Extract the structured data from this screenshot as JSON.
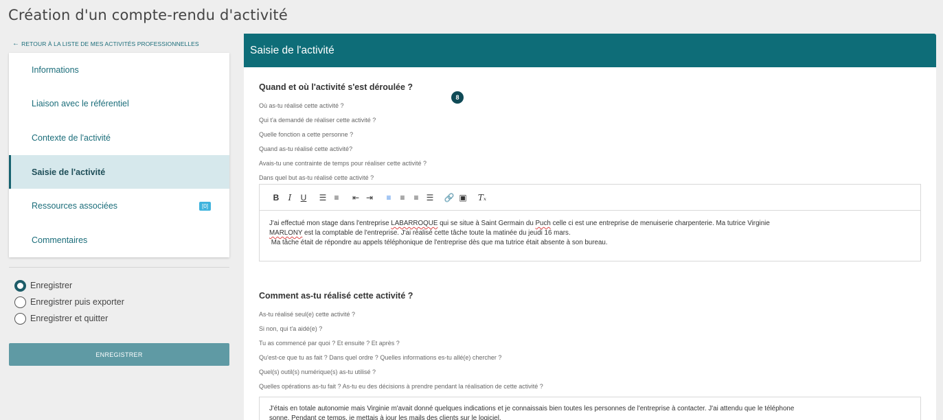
{
  "page": {
    "title": "Création d'un compte-rendu d'activité",
    "back_link": "RETOUR À LA LISTE DE MES ACTIVITÉS PROFESSIONNELLES"
  },
  "sidebar": {
    "items": [
      {
        "label": "Informations"
      },
      {
        "label": "Liaison avec le référentiel"
      },
      {
        "label": "Contexte de l'activité"
      },
      {
        "label": "Saisie de l'activité",
        "active": true
      },
      {
        "label": "Ressources associées",
        "badge": "[0]"
      },
      {
        "label": "Commentaires"
      }
    ]
  },
  "save_options": [
    {
      "label": "Enregistrer",
      "checked": true
    },
    {
      "label": "Enregistrer puis exporter",
      "checked": false
    },
    {
      "label": "Enregistrer et quitter",
      "checked": false
    }
  ],
  "save_button": "ENREGISTRER",
  "panel": {
    "title": "Saisie de l'activité",
    "section1": {
      "title": "Quand et où l'activité s'est déroulée ?",
      "badge": "8",
      "questions": [
        "Où as-tu réalisé cette activité ?",
        "Qui t'a demandé de réaliser cette activité ?",
        "Quelle fonction a cette personne ?",
        "Quand as-tu réalisé cette activité?",
        "Avais-tu une contrainte de temps pour réaliser cette activité ?",
        "Dans quel but as-tu réalisé cette activité ?"
      ],
      "content": {
        "p1_a": "J'ai effectué mon stage dans l'entreprise ",
        "p1_spell1": "LABARROQUE",
        "p1_b": " qui se situe à Saint Germain du ",
        "p1_spell2": "Puch",
        "p1_c": " celle ci est une entreprise de menuiserie charpenterie. Ma tutrice Virginie",
        "p2_spell": "MARLONY",
        "p2_rest": " est la comptable de l'entreprise. J'ai réalisé cette tâche toute la matinée du jeudi 16 mars.",
        "p3": " Ma tâche était de répondre au appels téléphonique de l'entreprise dès que ma tutrice était absente à son bureau."
      }
    },
    "section2": {
      "title": "Comment as-tu réalisé cette activité ?",
      "questions": [
        "As-tu réalisé seul(e) cette activité ?",
        "Si non, qui t'a aidé(e) ?",
        "Tu as commencé par quoi ? Et ensuite ? Et après ?",
        "Qu'est-ce que tu as fait ? Dans quel ordre ? Quelles informations es-tu allé(e) chercher ?",
        "Quel(s) outil(s) numérique(s) as-tu utilisé ?",
        "Quelles opérations as-tu fait ? As-tu eu des décisions à prendre pendant la réalisation de cette activité ?"
      ],
      "content": {
        "p1": "J'étais en totale autonomie mais Virginie m'avait donné quelques indications et je connaissais bien toutes les personnes de l'entreprise à contacter. J'ai attendu que le téléphone",
        "p2": "sonne. Pendant ce temps, je mettais à jour les mails des clients sur le logiciel."
      }
    }
  },
  "colors": {
    "header_teal": "#0e6d78",
    "active_nav_bg": "#d6e8ec",
    "save_button": "#5f9aa4",
    "badge_blue": "#3fb3dd"
  }
}
